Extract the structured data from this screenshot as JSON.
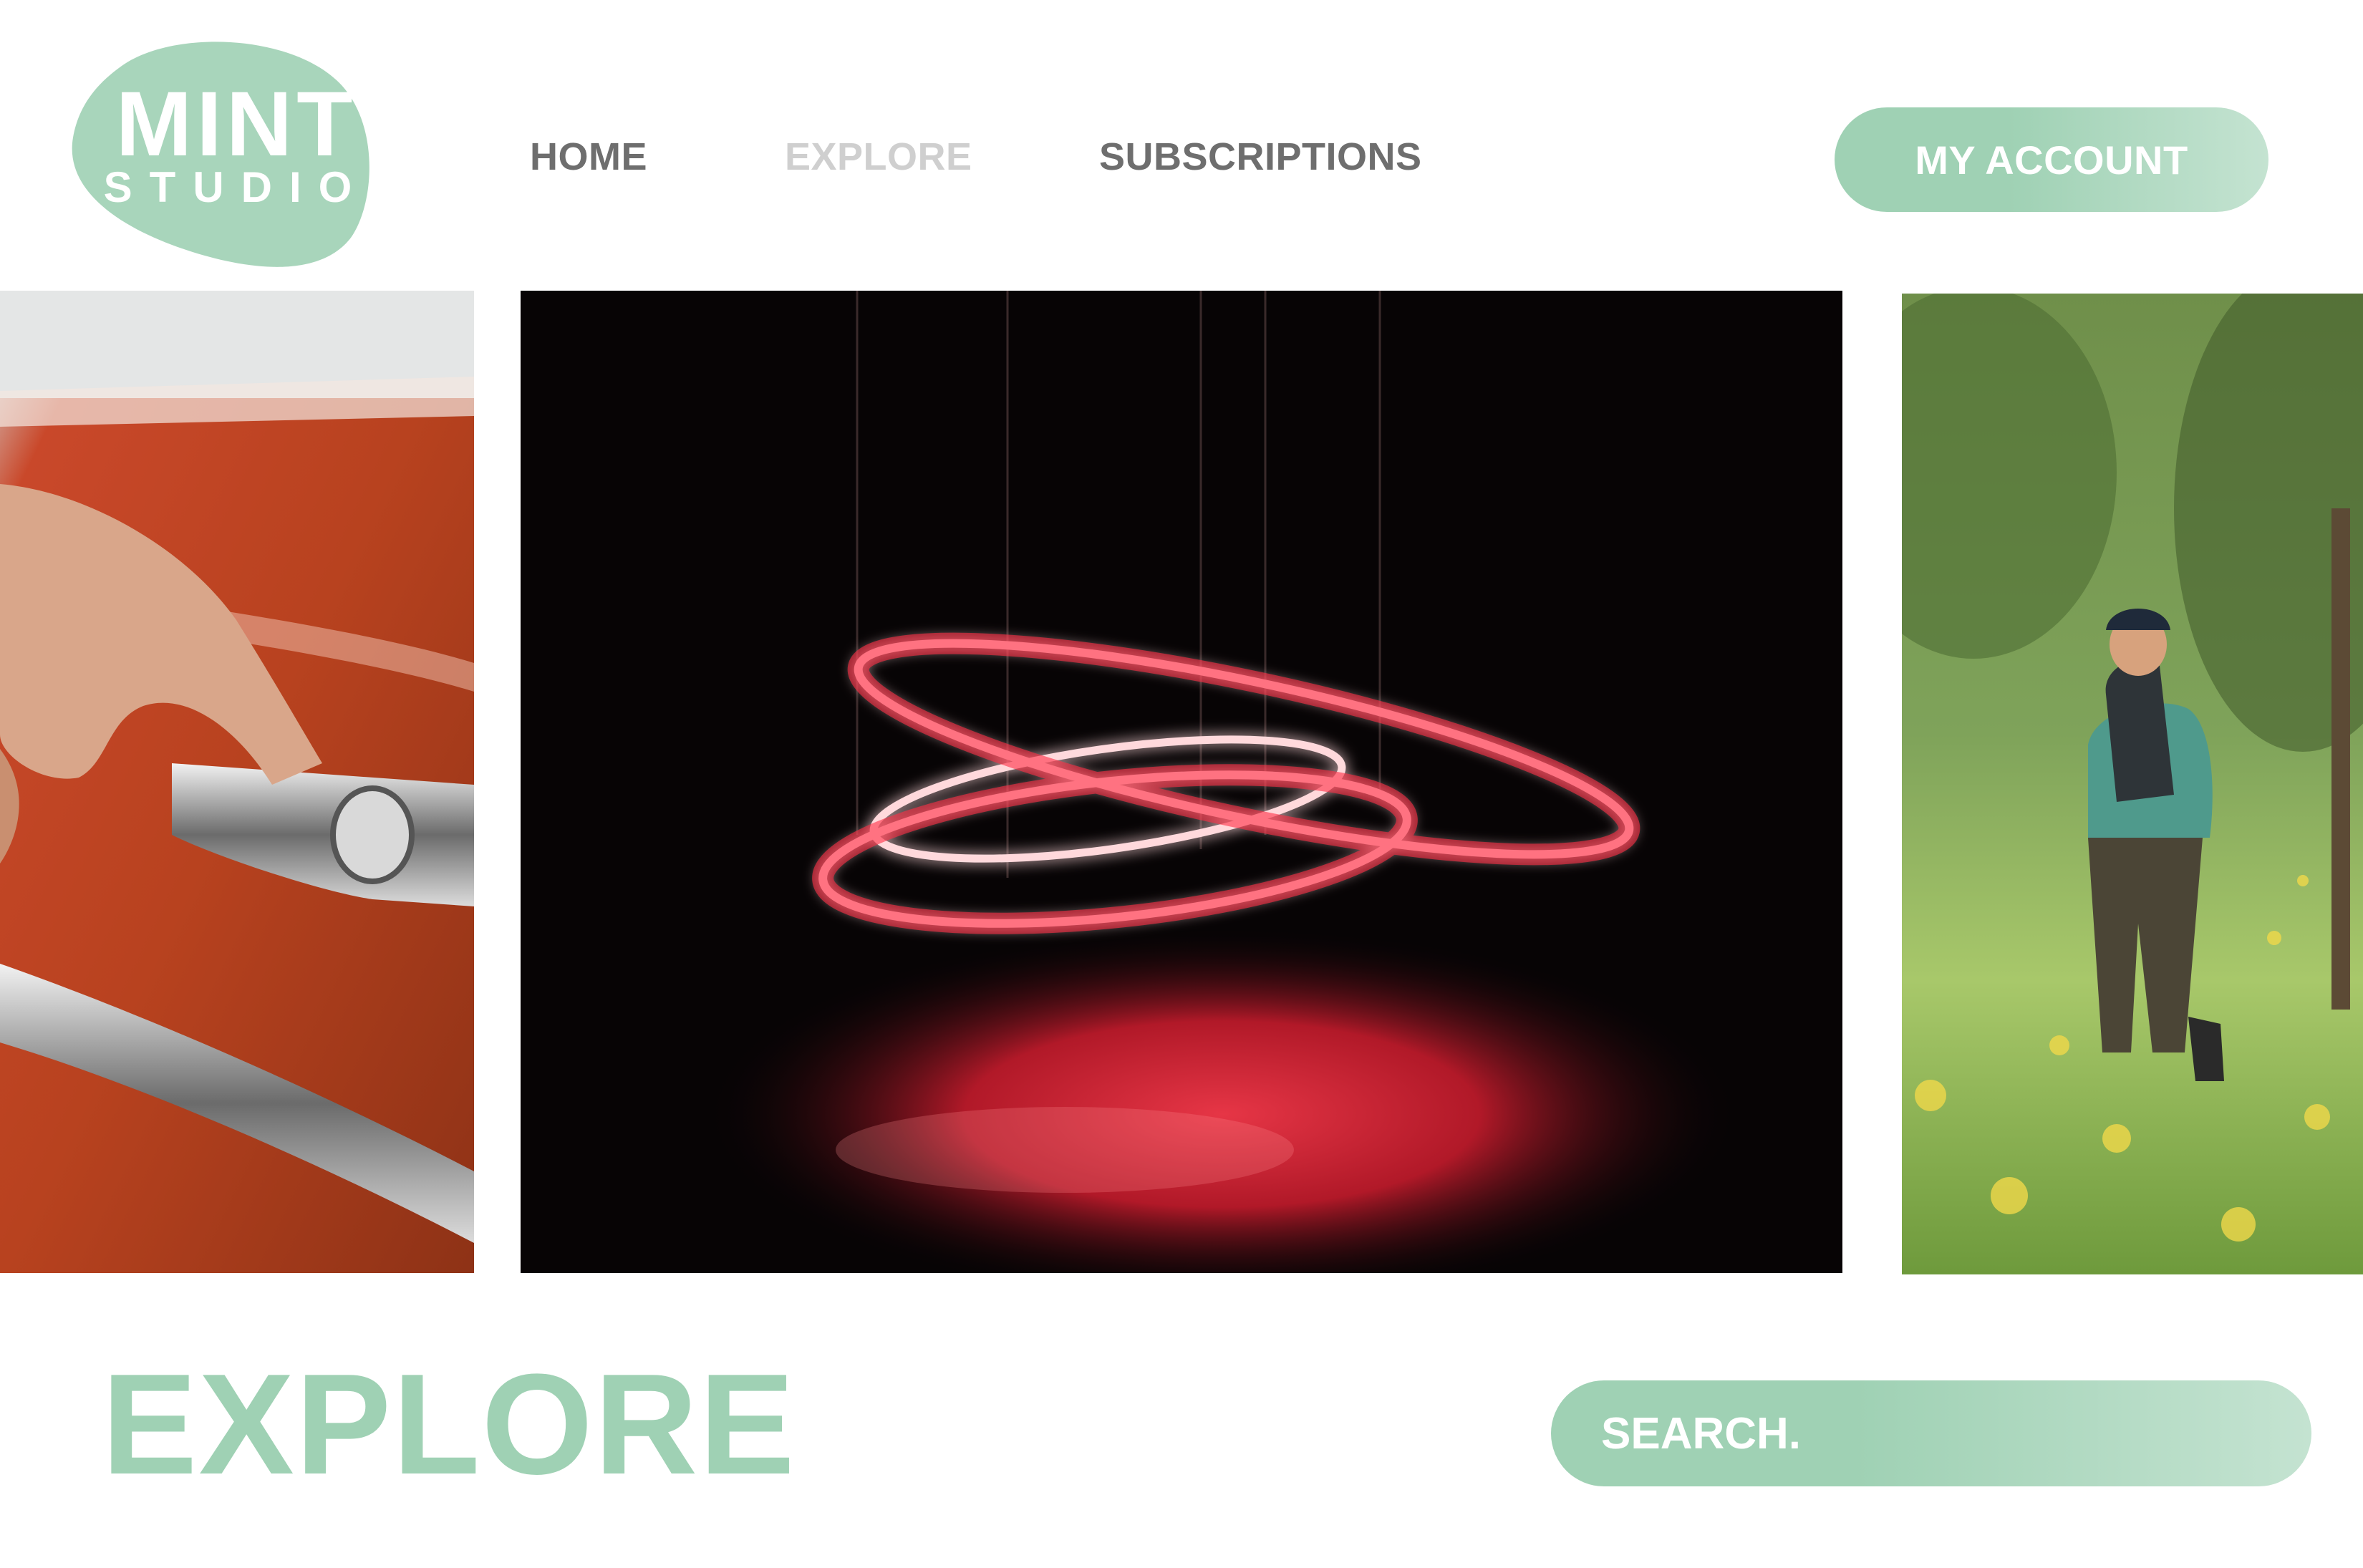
{
  "brand": {
    "logo_primary": "MINT",
    "logo_secondary": "STUDIO",
    "blob_color": "#a8d5bb"
  },
  "nav": {
    "items": [
      {
        "label": "HOME",
        "active": false
      },
      {
        "label": "EXPLORE",
        "active": true
      },
      {
        "label": "SUBSCRIPTIONS",
        "active": false
      }
    ],
    "account_label": "MY ACCOUNT"
  },
  "colors": {
    "accent": "#9fd1b4",
    "accent_light": "#c4e3d1",
    "nav_text": "#6e6e6e",
    "nav_active": "#cfcfcf"
  },
  "gallery": {
    "images": [
      {
        "icon": "car-door-handle-photo"
      },
      {
        "icon": "red-neon-rings-photo"
      },
      {
        "icon": "hiker-forest-photo"
      }
    ]
  },
  "main": {
    "title": "EXPLORE",
    "search_placeholder": "SEARCH."
  }
}
